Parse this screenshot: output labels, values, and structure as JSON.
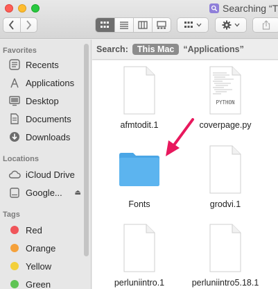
{
  "window": {
    "title": "Searching “T"
  },
  "toolbar": {
    "back_icon": "chevron-left-icon",
    "forward_icon": "chevron-right-icon",
    "view_modes": [
      "icon-view",
      "list-view",
      "column-view",
      "gallery-view"
    ],
    "active_view": "icon-view"
  },
  "sidebar": {
    "favorites_heading": "Favorites",
    "favorites": [
      {
        "label": "Recents",
        "icon": "clock-icon"
      },
      {
        "label": "Applications",
        "icon": "applications-icon"
      },
      {
        "label": "Desktop",
        "icon": "desktop-icon"
      },
      {
        "label": "Documents",
        "icon": "document-icon"
      },
      {
        "label": "Downloads",
        "icon": "download-icon"
      }
    ],
    "locations_heading": "Locations",
    "locations": [
      {
        "label": "iCloud Drive",
        "icon": "cloud-icon"
      },
      {
        "label": "Google...",
        "icon": "drive-icon"
      }
    ],
    "tags_heading": "Tags",
    "tags": [
      {
        "label": "Red",
        "color": "#f0555a"
      },
      {
        "label": "Orange",
        "color": "#f5a13b"
      },
      {
        "label": "Yellow",
        "color": "#f3d03c"
      },
      {
        "label": "Green",
        "color": "#5fc454"
      }
    ]
  },
  "search": {
    "label": "Search:",
    "scope_active": "This Mac",
    "scope_other": "“Applications”"
  },
  "files": [
    {
      "name": "afmtodit.1",
      "type": "document"
    },
    {
      "name": "coverpage.py",
      "type": "python",
      "badge": "PYTHON"
    },
    {
      "name": "Fonts",
      "type": "folder"
    },
    {
      "name": "grodvi.1",
      "type": "document"
    },
    {
      "name": "perluniintro.1",
      "type": "document"
    },
    {
      "name": "perluniintro5.18.1",
      "type": "document"
    }
  ],
  "colors": {
    "folder": "#5cb4ef",
    "arrow": "#e8185d",
    "active_scope": "#8c8c8c"
  }
}
